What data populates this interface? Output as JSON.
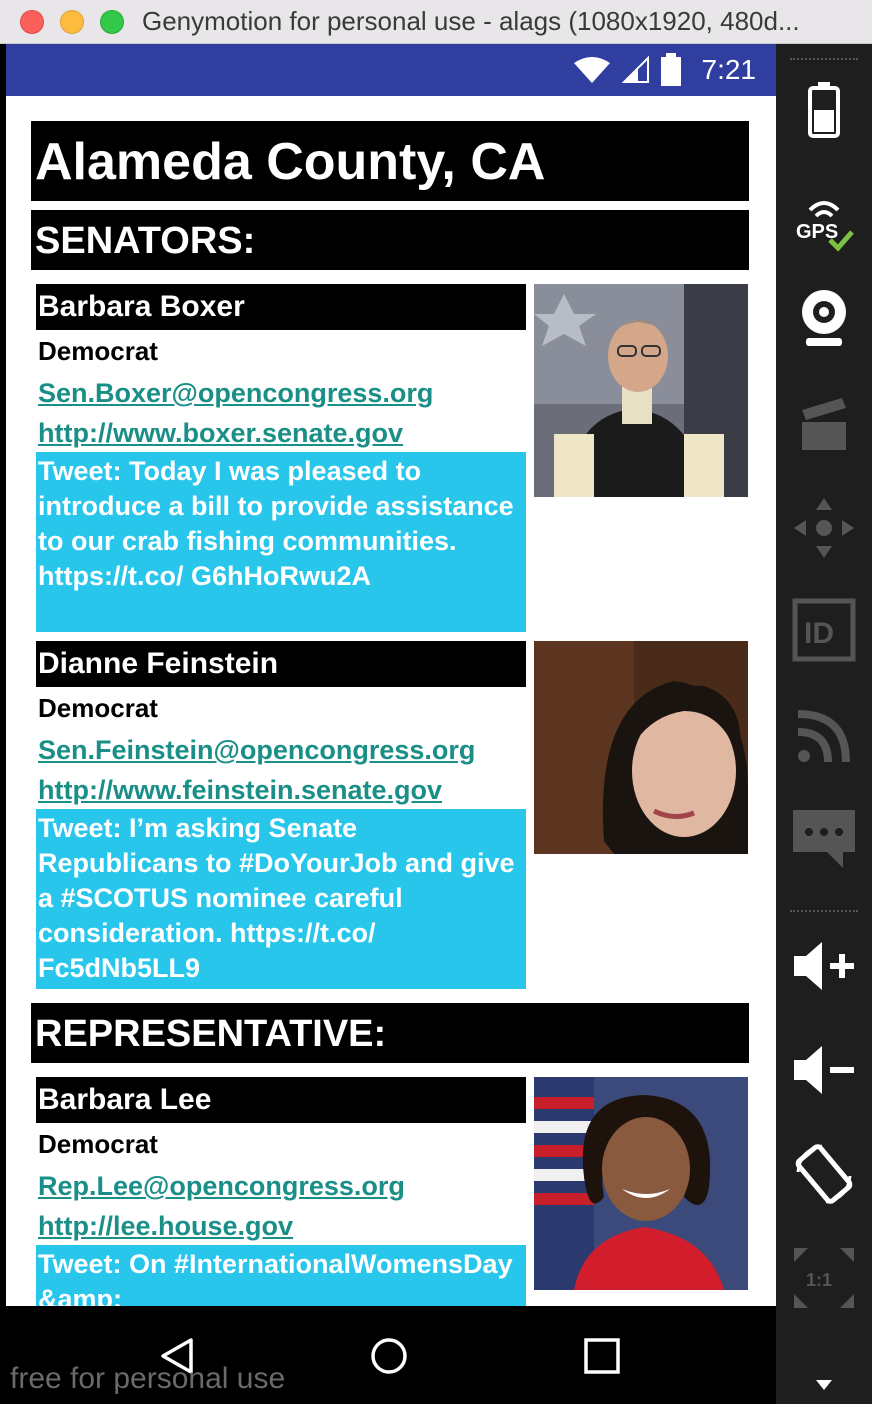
{
  "window": {
    "title": "Genymotion for personal use - alags (1080x1920, 480d..."
  },
  "statusbar": {
    "time": "7:21"
  },
  "county": "Alameda County, CA",
  "sections": {
    "senators": "SENATORS:",
    "representative": "REPRESENTATIVE:"
  },
  "senators": [
    {
      "name": "Barbara Boxer",
      "party": "Democrat",
      "email": "Sen.Boxer@opencongress.org",
      "website": "http://www.boxer.senate.gov",
      "tweet": "Tweet: Today I was pleased to introduce a bill to provide assistance to our crab fishing communities. https://t.co/ G6hHoRwu2A"
    },
    {
      "name": "Dianne Feinstein",
      "party": "Democrat",
      "email": "Sen.Feinstein@opencongress.org",
      "website": "http://www.feinstein.senate.gov",
      "tweet": "Tweet: I’m asking Senate Republicans to #DoYourJob and give a #SCOTUS nominee careful consideration. https://t.co/ Fc5dNb5LL9"
    }
  ],
  "representatives": [
    {
      "name": "Barbara Lee",
      "party": "Democrat",
      "email": "Rep.Lee@opencongress.org",
      "website": "http://lee.house.gov",
      "tweet": "Tweet: On #InternationalWomensDay &amp;"
    }
  ],
  "watermark": "free for personal use",
  "toolbar": {
    "gps_label": "GPS",
    "id_label": "ID",
    "scale_label": "1:1"
  },
  "colors": {
    "statusbar": "#303f9f",
    "link": "#1a8f87",
    "tweet_bg": "#29c6ec"
  }
}
